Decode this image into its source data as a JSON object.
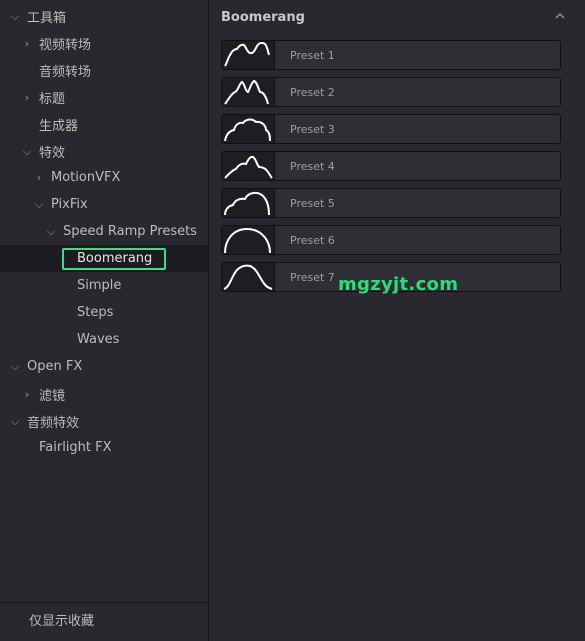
{
  "sidebar": {
    "items": [
      {
        "label": "工具箱",
        "chevron": "expanded"
      },
      {
        "label": "视频转场",
        "chevron": "collapsed"
      },
      {
        "label": "音频转场",
        "chevron": "none"
      },
      {
        "label": "标题",
        "chevron": "collapsed"
      },
      {
        "label": "生成器",
        "chevron": "none"
      },
      {
        "label": "特效",
        "chevron": "expanded"
      },
      {
        "label": "MotionVFX",
        "chevron": "collapsed"
      },
      {
        "label": "PixFix",
        "chevron": "expanded"
      },
      {
        "label": "Speed Ramp Presets",
        "chevron": "expanded"
      },
      {
        "label": "Boomerang",
        "chevron": "none",
        "selected": true
      },
      {
        "label": "Simple",
        "chevron": "none"
      },
      {
        "label": "Steps",
        "chevron": "none"
      },
      {
        "label": "Waves",
        "chevron": "none"
      },
      {
        "label": "Open FX",
        "chevron": "expanded"
      },
      {
        "label": "滤镜",
        "chevron": "collapsed"
      },
      {
        "label": "音频特效",
        "chevron": "expanded"
      },
      {
        "label": "Fairlight FX",
        "chevron": "none"
      }
    ],
    "favorites_label": "仅显示收藏"
  },
  "main": {
    "title": "Boomerang",
    "presets": [
      {
        "label": "Preset 1",
        "curve_icon": "wave-rising-curve"
      },
      {
        "label": "Preset 2",
        "curve_icon": "double-peak-curve"
      },
      {
        "label": "Preset 3",
        "curve_icon": "cloud-bumps-curve"
      },
      {
        "label": "Preset 4",
        "curve_icon": "bumpy-hill-curve"
      },
      {
        "label": "Preset 5",
        "curve_icon": "two-bump-curve"
      },
      {
        "label": "Preset 6",
        "curve_icon": "arch-curve"
      },
      {
        "label": "Preset 7",
        "curve_icon": "bell-curve"
      }
    ]
  },
  "watermark": "mgzyjt.com",
  "colors": {
    "selection_border": "#3fdc86",
    "watermark": "#27e07a",
    "background": "#28282e"
  }
}
